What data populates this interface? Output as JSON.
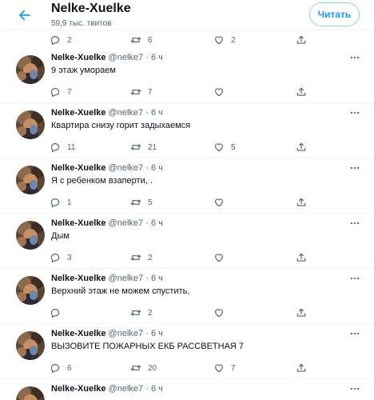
{
  "header": {
    "title": "Nelke-Xuelke",
    "subtitle": "59,9 тыс. твитов",
    "follow_label": "Читать"
  },
  "top_actions": {
    "replies": "2",
    "retweets": "6",
    "likes": "2"
  },
  "tweets": [
    {
      "author": "Nelke-Xuelke",
      "handle": "@nelke7",
      "dot": "·",
      "time": "6 ч",
      "text": "9 этаж умораем",
      "replies": "7",
      "retweets": "7",
      "likes": ""
    },
    {
      "author": "Nelke-Xuelke",
      "handle": "@nelke7",
      "dot": "·",
      "time": "6 ч",
      "text": "Квартира снизу горит задыхаемся",
      "replies": "11",
      "retweets": "21",
      "likes": "5"
    },
    {
      "author": "Nelke-Xuelke",
      "handle": "@nelke7",
      "dot": "·",
      "time": "6 ч",
      "text": "Я с ребенком взаперти, .",
      "replies": "1",
      "retweets": "5",
      "likes": ""
    },
    {
      "author": "Nelke-Xuelke",
      "handle": "@nelke7",
      "dot": "·",
      "time": "6 ч",
      "text": "Дым",
      "replies": "3",
      "retweets": "2",
      "likes": ""
    },
    {
      "author": "Nelke-Xuelke",
      "handle": "@nelke7",
      "dot": "·",
      "time": "6 ч",
      "text": "Верхний этаж не можем спустить,",
      "replies": "",
      "retweets": "2",
      "likes": ""
    },
    {
      "author": "Nelke-Xuelke",
      "handle": "@nelke7",
      "dot": "·",
      "time": "6 ч",
      "text": "ВЫЗОВИТЕ ПОЖАРНЫХ ЕКБ РАССВЕТНАЯ 7",
      "replies": "6",
      "retweets": "20",
      "likes": "7"
    },
    {
      "author": "Nelke-Xuelke",
      "handle": "@nelke7",
      "dot": "·",
      "time": "6 ч",
      "text": "",
      "replies": "",
      "retweets": "",
      "likes": ""
    }
  ],
  "icons": {
    "back": "arrow-left-icon",
    "more": "more-horizontal-icon",
    "reply": "reply-icon",
    "retweet": "retweet-icon",
    "like": "heart-icon",
    "share": "share-icon"
  },
  "colors": {
    "accent": "#1d9bf0",
    "text": "#0f1419",
    "secondary": "#536471",
    "border": "#eff3f4"
  }
}
